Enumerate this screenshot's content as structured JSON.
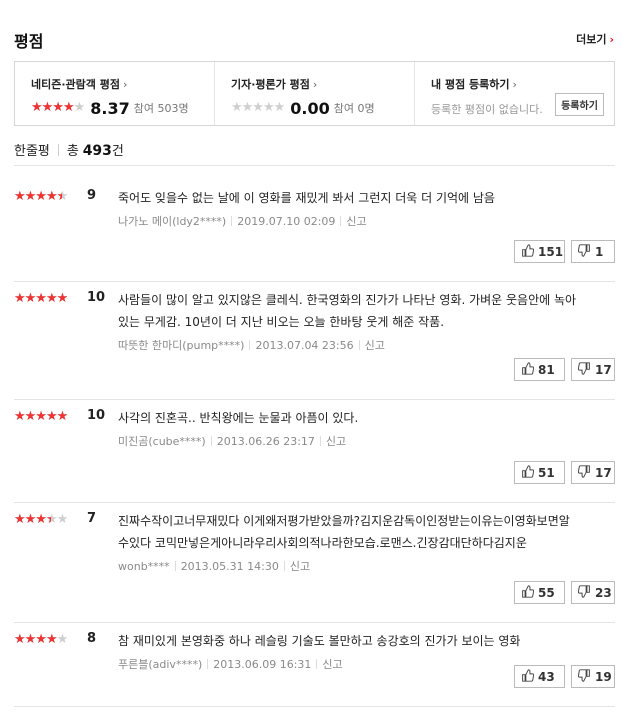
{
  "section": {
    "title": "평점",
    "more_label": "더보기"
  },
  "summary": {
    "audience": {
      "label": "네티즌·관람객 평점",
      "score": "8.37",
      "count": "참여 503명",
      "stars": 4
    },
    "critic": {
      "label": "기자·평론가 평점",
      "score": "0.00",
      "count": "참여 0명",
      "stars": 0
    },
    "mine": {
      "label": "내 평점 등록하기",
      "desc": "등록한 평점이 없습니다.",
      "button": "등록하기"
    }
  },
  "reviews_header": {
    "label": "한줄평",
    "total_prefix": "총",
    "total": "493",
    "total_suffix": "건"
  },
  "vote_labels": {
    "up": "공감",
    "down": "비공감"
  },
  "reviews": [
    {
      "stars": 4.5,
      "score": "9",
      "lines": [
        "죽어도 잊을수 없는 날에 이 영화를 재밌게 봐서 그런지 더욱 더 기억에 남음"
      ],
      "user": "나가노 메이(ldy2****)",
      "date": "2019.07.10 02:09",
      "report": "신고",
      "up": "151",
      "down": "1"
    },
    {
      "stars": 5,
      "score": "10",
      "lines": [
        "사람들이 많이 알고 있지않은 클레식. 한국영화의 진가가 나타난 영화. 가벼운 웃음안에 녹아",
        "있는 무게감. 10년이 더 지난 비오는 오늘 한바탕 웃게 해준 작품."
      ],
      "user": "따뜻한 한마디(pump****)",
      "date": "2013.07.04 23:56",
      "report": "신고",
      "up": "81",
      "down": "17"
    },
    {
      "stars": 5,
      "score": "10",
      "lines": [
        "사각의 진혼곡.. 반칙왕에는 눈물과 아픔이 있다."
      ],
      "user": "미진곰(cube****)",
      "date": "2013.06.26 23:17",
      "report": "신고",
      "up": "51",
      "down": "17"
    },
    {
      "stars": 3.5,
      "score": "7",
      "lines": [
        "진짜수작이고너무재밌다 이게왜저평가받았을까?김지운감독이인정받는이유는이영화보면알",
        "수있다 코믹만넣은게아니라우리사회의적나라한모습.로맨스.긴장감대단하다김지운"
      ],
      "user": "wonb****",
      "date": "2013.05.31 14:30",
      "report": "신고",
      "up": "55",
      "down": "23"
    },
    {
      "stars": 4,
      "score": "8",
      "lines": [
        "참 재미있게 본영화중 하나 레슬링 기술도 볼만하고 송강호의 진가가 보이는 영화"
      ],
      "user": "푸른블(adiv****)",
      "date": "2013.06.09 16:31",
      "report": "신고",
      "up": "43",
      "down": "19"
    }
  ],
  "colors": {
    "star_active": "#e33333",
    "star_inactive": "#cfcfcf",
    "accent": "#e11111"
  },
  "icons": {
    "thumbs_up": "thumbs-up-icon",
    "thumbs_down": "thumbs-down-icon",
    "chevron": "chevron-right-icon"
  }
}
